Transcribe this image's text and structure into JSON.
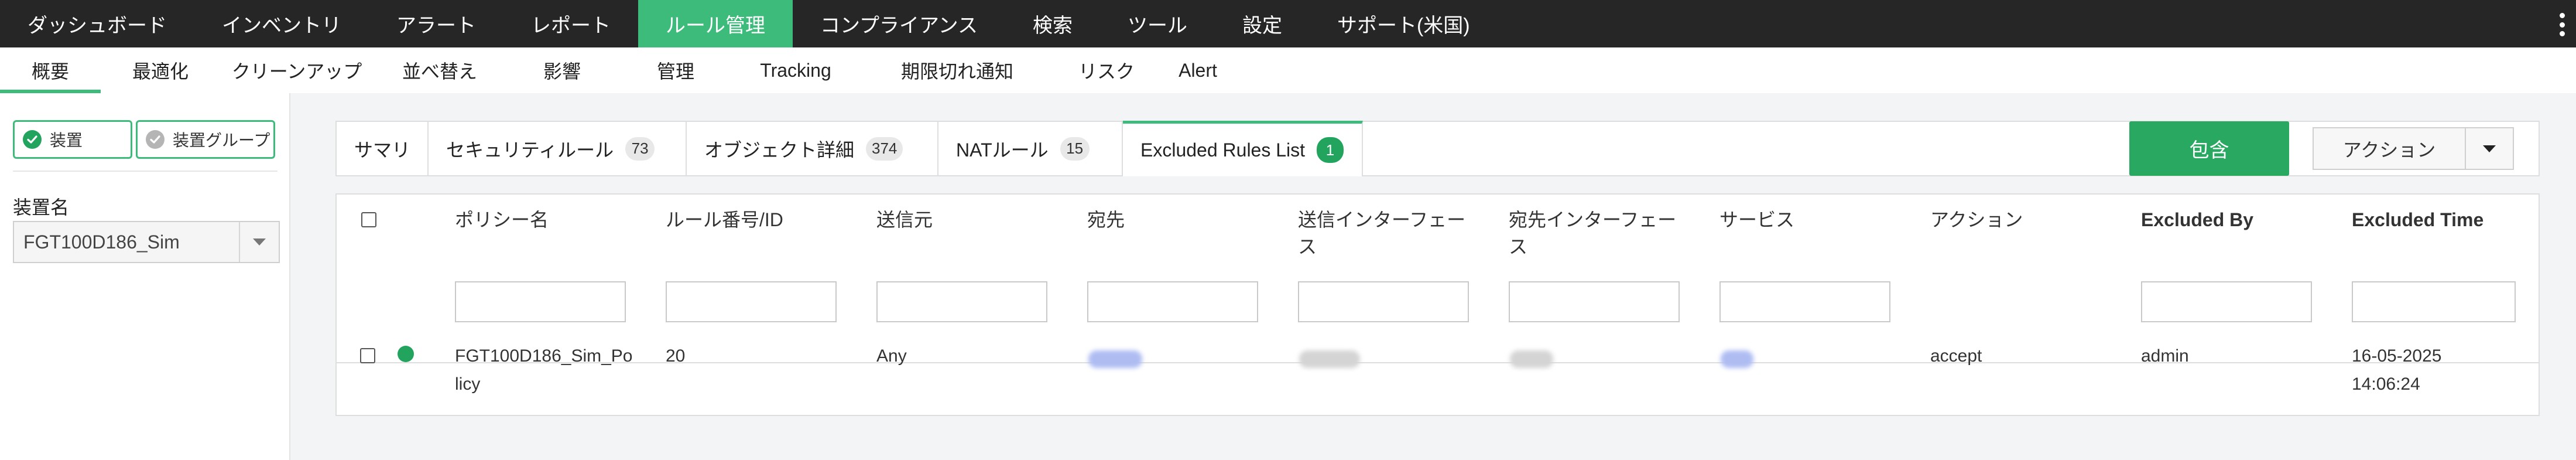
{
  "top_nav": {
    "items": [
      "ダッシュボード",
      "インベントリ",
      "アラート",
      "レポート",
      "ルール管理",
      "コンプライアンス",
      "検索",
      "ツール",
      "設定",
      "サポート(米国)"
    ],
    "active_index": 4
  },
  "sub_nav": {
    "items": [
      "概要",
      "最適化",
      "クリーンアップ",
      "並べ替え",
      "影響",
      "管理",
      "Tracking",
      "期限切れ通知",
      "リスク",
      "Alert"
    ],
    "active_index": 0
  },
  "sidebar": {
    "device_button": "装置",
    "device_group_button": "装置グループ",
    "device_name_label": "装置名",
    "device_select_value": "FGT100D186_Sim"
  },
  "tabs": [
    {
      "label": "サマリ"
    },
    {
      "label": "セキュリティルール",
      "count": "73"
    },
    {
      "label": "オブジェクト詳細",
      "count": "374"
    },
    {
      "label": "NATルール",
      "count": "15"
    },
    {
      "label": "Excluded Rules List",
      "count": "1"
    }
  ],
  "active_tab_index": 4,
  "toolbar": {
    "include_label": "包含",
    "action_label": "アクション"
  },
  "table": {
    "columns": [
      "ポリシー名",
      "ルール番号/ID",
      "送信元",
      "宛先",
      "送信インターフェース",
      "宛先インターフェース",
      "サービス",
      "アクション",
      "Excluded By",
      "Excluded Time"
    ],
    "columns_line1": [
      "ポリシー名",
      "ルール番号/ID",
      "送信元",
      "宛先",
      "送信インターフェー",
      "宛先インターフェー",
      "サービス",
      "アクション",
      "Excluded By",
      "Excluded Time"
    ],
    "columns_line2": [
      "",
      "",
      "",
      "",
      "ス",
      "ス",
      "",
      "",
      "",
      ""
    ],
    "rows": [
      {
        "policy_name_line1": "FGT100D186_Sim_Po",
        "policy_name_line2": "licy",
        "rule_id": "20",
        "source": "Any",
        "action": "accept",
        "excluded_by": "admin",
        "excluded_date": "16-05-2025",
        "excluded_time": "14:06:24",
        "status_color": "#22a45f"
      }
    ]
  },
  "colors": {
    "accent": "#3dbb7b",
    "include_button": "#29a862",
    "top_nav_bg": "#262626"
  }
}
